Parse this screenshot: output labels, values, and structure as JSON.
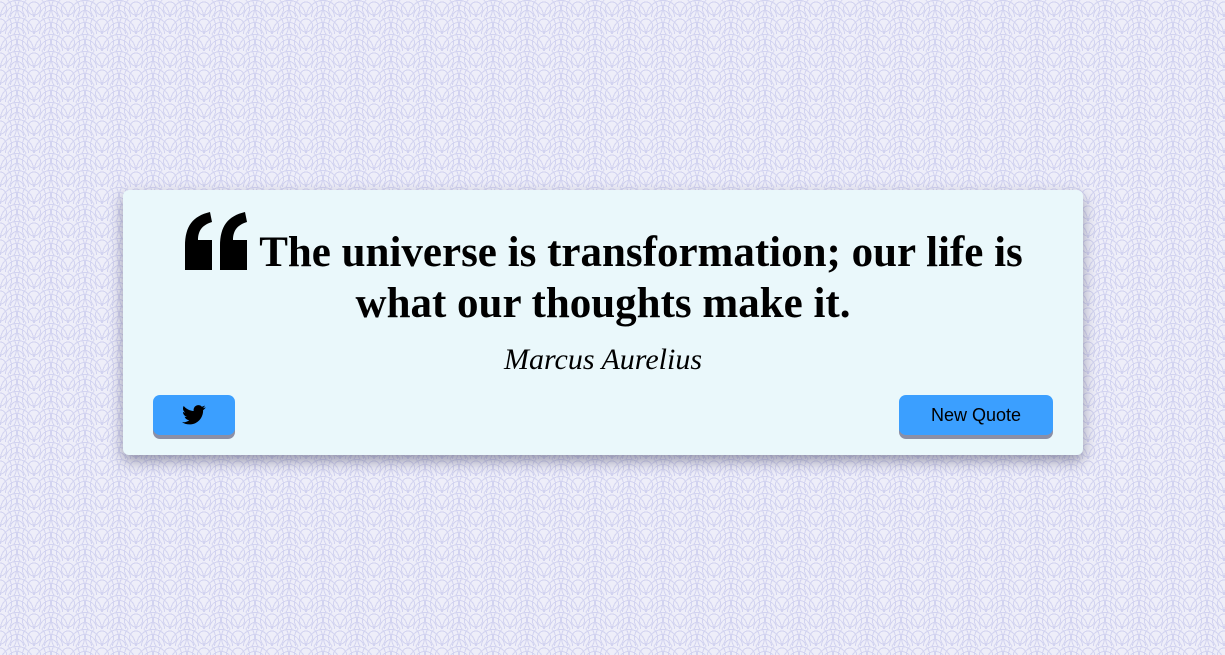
{
  "quote": {
    "text": "The universe is transformation; our life is what our thoughts make it.",
    "author": "Marcus Aurelius",
    "icon": "quote-left-icon"
  },
  "actions": {
    "tweet_icon": "twitter-icon",
    "new_quote_label": "New Quote"
  },
  "colors": {
    "button": "#3b9fff",
    "card_background": "#eaf8fb",
    "page_pattern": "#d2d3f0"
  }
}
